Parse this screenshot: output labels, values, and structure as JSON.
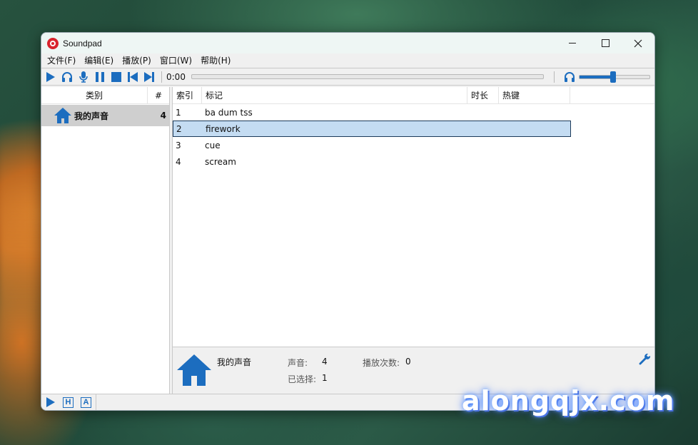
{
  "window": {
    "title": "Soundpad"
  },
  "menu": [
    "文件(F)",
    "编辑(E)",
    "播放(P)",
    "窗口(W)",
    "帮助(H)"
  ],
  "toolbar": {
    "time": "0:00",
    "volume_level": 0.48
  },
  "sidebar": {
    "header_name": "类别",
    "header_count": "#",
    "categories": [
      {
        "label": "我的声音",
        "count": "4"
      }
    ]
  },
  "table": {
    "columns": [
      "索引",
      "标记",
      "时长",
      "热键"
    ],
    "rows": [
      {
        "index": "1",
        "tag": "ba dum tss",
        "selected": false
      },
      {
        "index": "2",
        "tag": "firework",
        "selected": true
      },
      {
        "index": "3",
        "tag": "cue",
        "selected": false
      },
      {
        "index": "4",
        "tag": "scream",
        "selected": false
      }
    ]
  },
  "info": {
    "category": "我的声音",
    "sounds_label": "声音:",
    "sounds_value": "4",
    "plays_label": "播放次数:",
    "plays_value": "0",
    "selected_label": "已选择:",
    "selected_value": "1"
  },
  "statusbar": {
    "h_label": "H",
    "a_label": "A"
  },
  "watermark": "alongqjx.com",
  "colors": {
    "accent": "#1c6dbf",
    "selection": "#c4dcf2"
  }
}
